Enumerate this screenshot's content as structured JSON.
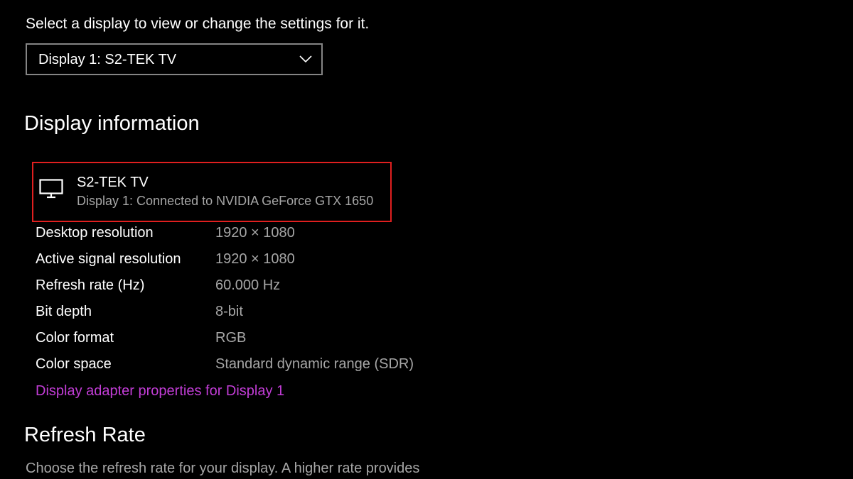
{
  "display_select": {
    "prompt": "Select a display to view or change the settings for it.",
    "selected": "Display 1: S2-TEK TV"
  },
  "display_info": {
    "heading": "Display information",
    "card": {
      "title": "S2-TEK TV",
      "subtitle": "Display 1: Connected to NVIDIA GeForce GTX 1650",
      "icon": "monitor-icon"
    },
    "rows": [
      {
        "label": "Desktop resolution",
        "value": "1920 × 1080"
      },
      {
        "label": "Active signal resolution",
        "value": "1920 × 1080"
      },
      {
        "label": "Refresh rate (Hz)",
        "value": "60.000 Hz"
      },
      {
        "label": "Bit depth",
        "value": "8-bit"
      },
      {
        "label": "Color format",
        "value": "RGB"
      },
      {
        "label": "Color space",
        "value": "Standard dynamic range (SDR)"
      }
    ],
    "adapter_link": "Display adapter properties for Display 1"
  },
  "refresh_rate": {
    "heading": "Refresh Rate",
    "description": "Choose the refresh rate for your display. A higher rate provides"
  },
  "colors": {
    "background": "#000000",
    "text_primary": "#ffffff",
    "text_secondary": "#a6a6a6",
    "link_accent": "#c23dd6",
    "highlight_border": "#e01f1f",
    "dropdown_border": "#858585"
  }
}
